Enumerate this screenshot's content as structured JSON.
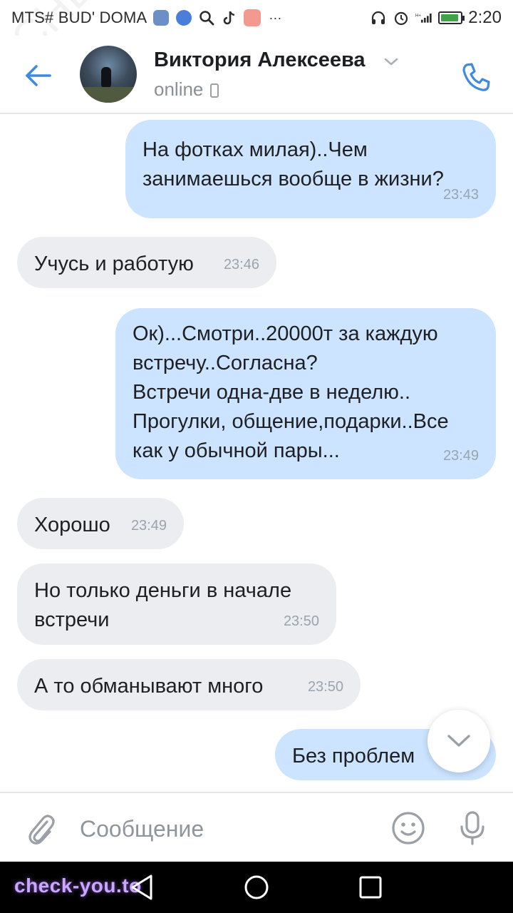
{
  "status_bar": {
    "carrier": "MTS# BUD' DOMA",
    "icons": [
      "app-icon",
      "messenger-icon",
      "search-icon",
      "tiktok-icon",
      "app-icon",
      "more-icon"
    ],
    "right_icons": [
      "headphones-icon",
      "alarm-icon",
      "signal-icon",
      "battery-icon"
    ],
    "clock": "2:20",
    "more": "···",
    "battery_level": 0.9,
    "battery_color": "#3fa34d"
  },
  "header": {
    "contact_name": "Виктория Алексеева",
    "contact_status": "online",
    "accent_color": "#3f8ae0"
  },
  "messages": [
    {
      "direction": "out",
      "text": "На фотках милая)..Чем\nзанимаешься вообще в жизни?",
      "time": "23:43"
    },
    {
      "direction": "in",
      "text": "Учусь и работую",
      "time": "23:46"
    },
    {
      "direction": "out",
      "text": "Ок)...Смотри..20000т за каждую\nвстречу..Согласна?\nВстречи одна-две в неделю..\nПрогулки, общение,подарки..Все\nкак у обычной пары...",
      "time": "23:49"
    },
    {
      "direction": "in",
      "text": "Хорошо",
      "time": "23:49"
    },
    {
      "direction": "in",
      "text": "Но только деньги в начале\nвстречи",
      "time": "23:50"
    },
    {
      "direction": "in",
      "text": "А то обманывают много",
      "time": "23:50"
    },
    {
      "direction": "out",
      "text": "Без проблем",
      "time": ""
    }
  ],
  "bubble_colors": {
    "out": "#cce4ff",
    "in": "#ebedf0"
  },
  "composer": {
    "placeholder": "Сообщение"
  },
  "watermarks": {
    "bottom": "check-you.to",
    "diagonal": "CHECK-YOU.ME"
  }
}
